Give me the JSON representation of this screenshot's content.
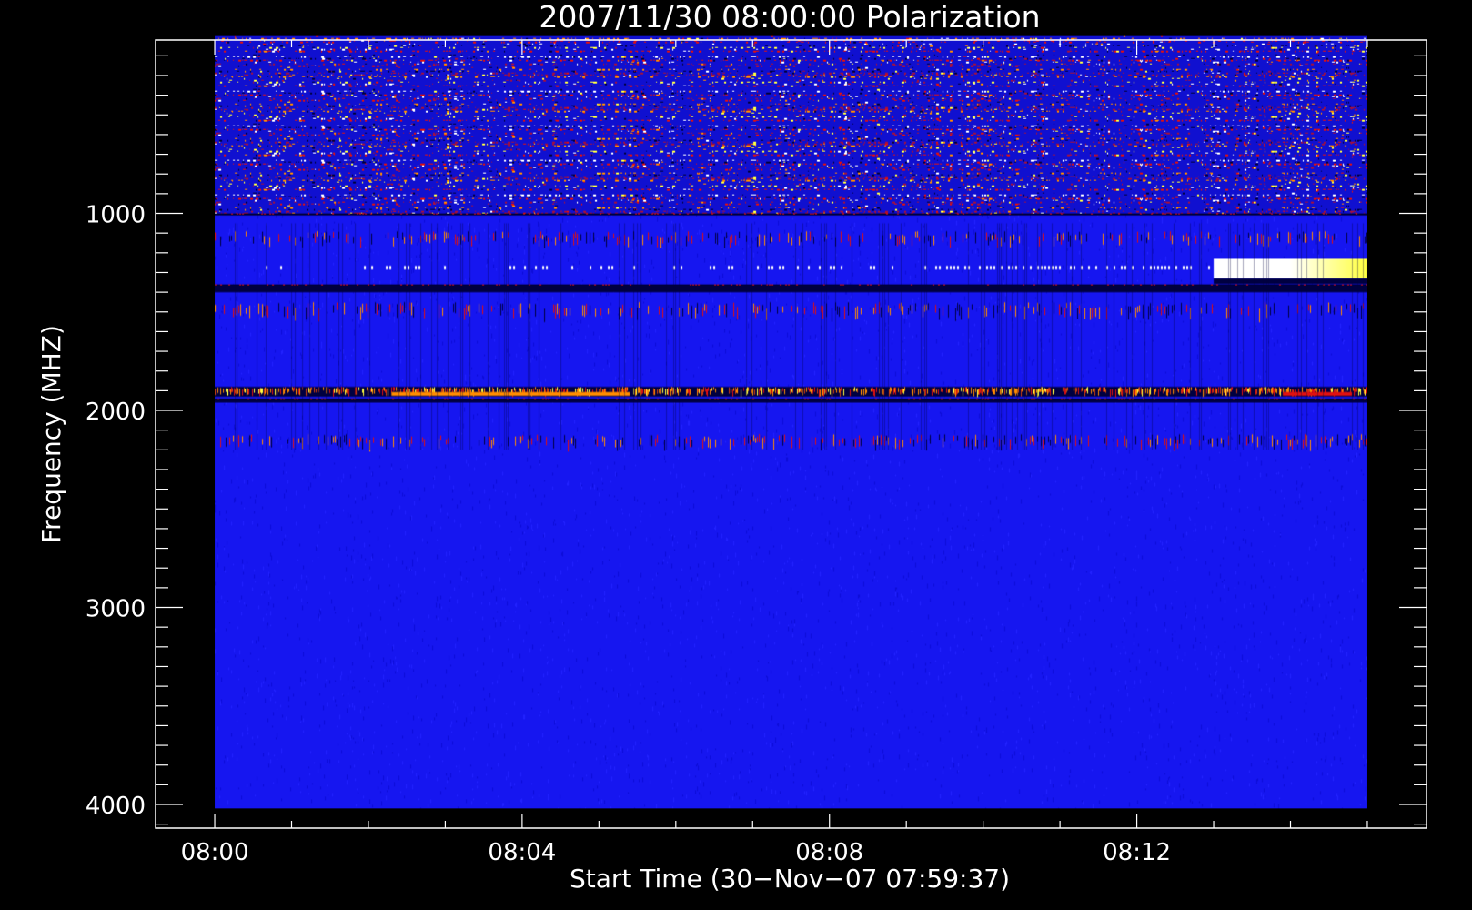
{
  "chart_data": {
    "type": "heatmap",
    "title": "2007/11/30 08:00:00 Polarization",
    "xlabel": "Start Time (30−Nov−07 07:59:37)",
    "ylabel": "Frequency (MHZ)",
    "x_ticks": [
      "08:00",
      "08:04",
      "08:08",
      "08:12"
    ],
    "x_tick_minutes": [
      0,
      4,
      8,
      12
    ],
    "x_range_minutes": [
      -0.77,
      15.77
    ],
    "data_x_range_minutes": [
      0,
      15
    ],
    "y_ticks": [
      1000,
      2000,
      3000,
      4000
    ],
    "y_range": [
      120,
      4120
    ],
    "y_reversed": true,
    "data_y_range": [
      100,
      4020
    ],
    "grid": false,
    "colors": {
      "background": "#000000",
      "axes": "#ffffff",
      "base": "#1616f0",
      "dark": "#000040",
      "red": "#e01010",
      "orange": "#ff8c00",
      "yellow": "#ffff40",
      "white": "#ffffff"
    },
    "bands": [
      {
        "freq_from": 100,
        "freq_to": 1000,
        "pattern": "noisy"
      },
      {
        "freq_from": 1000,
        "freq_to": 1010,
        "pattern": "dark line"
      },
      {
        "freq_from": 1090,
        "freq_to": 1150,
        "pattern": "red streaks"
      },
      {
        "freq_from": 1250,
        "freq_to": 1290,
        "pattern": "white dashes"
      },
      {
        "freq_from": 1230,
        "freq_to": 1330,
        "pattern": "white burst",
        "time_from_min": 13.0,
        "time_to_min": 15.0
      },
      {
        "freq_from": 1360,
        "freq_to": 1400,
        "pattern": "dark line"
      },
      {
        "freq_from": 1450,
        "freq_to": 1520,
        "pattern": "red streaks"
      },
      {
        "freq_from": 1880,
        "freq_to": 1930,
        "pattern": "orange burst"
      },
      {
        "freq_from": 1940,
        "freq_to": 1960,
        "pattern": "dark line"
      },
      {
        "freq_from": 2120,
        "freq_to": 2180,
        "pattern": "red streaks"
      }
    ]
  }
}
